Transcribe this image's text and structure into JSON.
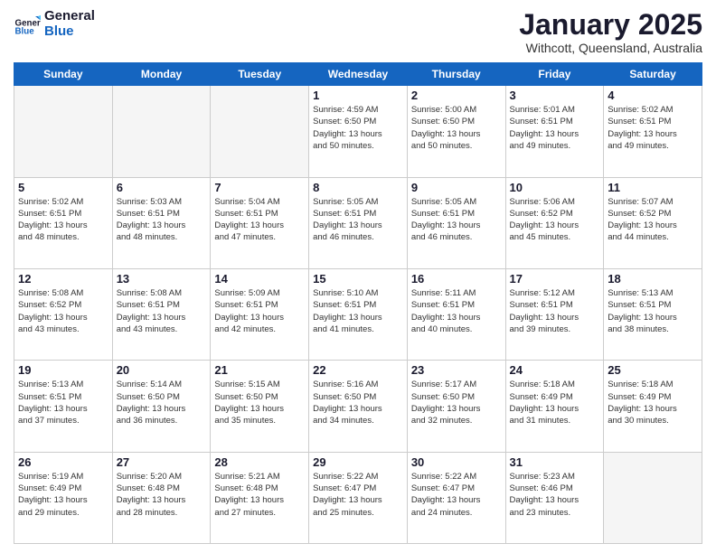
{
  "header": {
    "logo_general": "General",
    "logo_blue": "Blue",
    "month_title": "January 2025",
    "location": "Withcott, Queensland, Australia"
  },
  "days_of_week": [
    "Sunday",
    "Monday",
    "Tuesday",
    "Wednesday",
    "Thursday",
    "Friday",
    "Saturday"
  ],
  "weeks": [
    [
      {
        "num": "",
        "info": ""
      },
      {
        "num": "",
        "info": ""
      },
      {
        "num": "",
        "info": ""
      },
      {
        "num": "1",
        "info": "Sunrise: 4:59 AM\nSunset: 6:50 PM\nDaylight: 13 hours\nand 50 minutes."
      },
      {
        "num": "2",
        "info": "Sunrise: 5:00 AM\nSunset: 6:50 PM\nDaylight: 13 hours\nand 50 minutes."
      },
      {
        "num": "3",
        "info": "Sunrise: 5:01 AM\nSunset: 6:51 PM\nDaylight: 13 hours\nand 49 minutes."
      },
      {
        "num": "4",
        "info": "Sunrise: 5:02 AM\nSunset: 6:51 PM\nDaylight: 13 hours\nand 49 minutes."
      }
    ],
    [
      {
        "num": "5",
        "info": "Sunrise: 5:02 AM\nSunset: 6:51 PM\nDaylight: 13 hours\nand 48 minutes."
      },
      {
        "num": "6",
        "info": "Sunrise: 5:03 AM\nSunset: 6:51 PM\nDaylight: 13 hours\nand 48 minutes."
      },
      {
        "num": "7",
        "info": "Sunrise: 5:04 AM\nSunset: 6:51 PM\nDaylight: 13 hours\nand 47 minutes."
      },
      {
        "num": "8",
        "info": "Sunrise: 5:05 AM\nSunset: 6:51 PM\nDaylight: 13 hours\nand 46 minutes."
      },
      {
        "num": "9",
        "info": "Sunrise: 5:05 AM\nSunset: 6:51 PM\nDaylight: 13 hours\nand 46 minutes."
      },
      {
        "num": "10",
        "info": "Sunrise: 5:06 AM\nSunset: 6:52 PM\nDaylight: 13 hours\nand 45 minutes."
      },
      {
        "num": "11",
        "info": "Sunrise: 5:07 AM\nSunset: 6:52 PM\nDaylight: 13 hours\nand 44 minutes."
      }
    ],
    [
      {
        "num": "12",
        "info": "Sunrise: 5:08 AM\nSunset: 6:52 PM\nDaylight: 13 hours\nand 43 minutes."
      },
      {
        "num": "13",
        "info": "Sunrise: 5:08 AM\nSunset: 6:51 PM\nDaylight: 13 hours\nand 43 minutes."
      },
      {
        "num": "14",
        "info": "Sunrise: 5:09 AM\nSunset: 6:51 PM\nDaylight: 13 hours\nand 42 minutes."
      },
      {
        "num": "15",
        "info": "Sunrise: 5:10 AM\nSunset: 6:51 PM\nDaylight: 13 hours\nand 41 minutes."
      },
      {
        "num": "16",
        "info": "Sunrise: 5:11 AM\nSunset: 6:51 PM\nDaylight: 13 hours\nand 40 minutes."
      },
      {
        "num": "17",
        "info": "Sunrise: 5:12 AM\nSunset: 6:51 PM\nDaylight: 13 hours\nand 39 minutes."
      },
      {
        "num": "18",
        "info": "Sunrise: 5:13 AM\nSunset: 6:51 PM\nDaylight: 13 hours\nand 38 minutes."
      }
    ],
    [
      {
        "num": "19",
        "info": "Sunrise: 5:13 AM\nSunset: 6:51 PM\nDaylight: 13 hours\nand 37 minutes."
      },
      {
        "num": "20",
        "info": "Sunrise: 5:14 AM\nSunset: 6:50 PM\nDaylight: 13 hours\nand 36 minutes."
      },
      {
        "num": "21",
        "info": "Sunrise: 5:15 AM\nSunset: 6:50 PM\nDaylight: 13 hours\nand 35 minutes."
      },
      {
        "num": "22",
        "info": "Sunrise: 5:16 AM\nSunset: 6:50 PM\nDaylight: 13 hours\nand 34 minutes."
      },
      {
        "num": "23",
        "info": "Sunrise: 5:17 AM\nSunset: 6:50 PM\nDaylight: 13 hours\nand 32 minutes."
      },
      {
        "num": "24",
        "info": "Sunrise: 5:18 AM\nSunset: 6:49 PM\nDaylight: 13 hours\nand 31 minutes."
      },
      {
        "num": "25",
        "info": "Sunrise: 5:18 AM\nSunset: 6:49 PM\nDaylight: 13 hours\nand 30 minutes."
      }
    ],
    [
      {
        "num": "26",
        "info": "Sunrise: 5:19 AM\nSunset: 6:49 PM\nDaylight: 13 hours\nand 29 minutes."
      },
      {
        "num": "27",
        "info": "Sunrise: 5:20 AM\nSunset: 6:48 PM\nDaylight: 13 hours\nand 28 minutes."
      },
      {
        "num": "28",
        "info": "Sunrise: 5:21 AM\nSunset: 6:48 PM\nDaylight: 13 hours\nand 27 minutes."
      },
      {
        "num": "29",
        "info": "Sunrise: 5:22 AM\nSunset: 6:47 PM\nDaylight: 13 hours\nand 25 minutes."
      },
      {
        "num": "30",
        "info": "Sunrise: 5:22 AM\nSunset: 6:47 PM\nDaylight: 13 hours\nand 24 minutes."
      },
      {
        "num": "31",
        "info": "Sunrise: 5:23 AM\nSunset: 6:46 PM\nDaylight: 13 hours\nand 23 minutes."
      },
      {
        "num": "",
        "info": ""
      }
    ]
  ]
}
